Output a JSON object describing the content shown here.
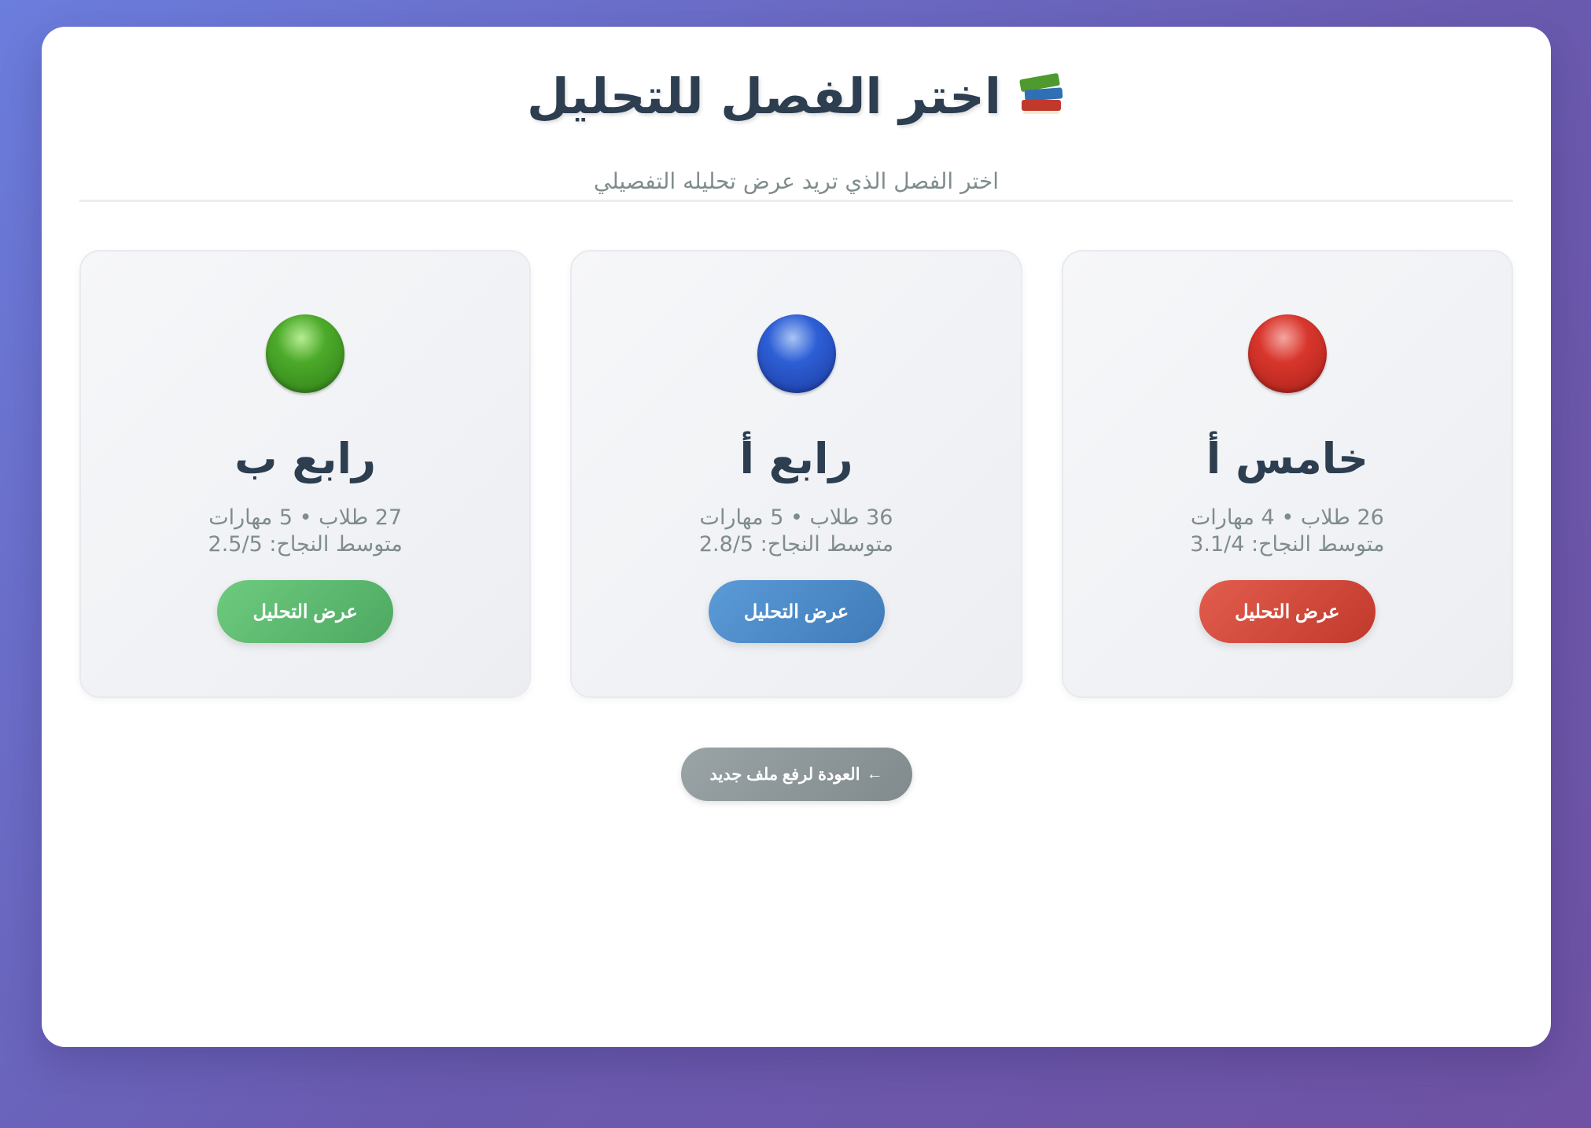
{
  "header": {
    "title": "اختر الفصل للتحليل",
    "title_icon": "books-icon",
    "subtitle": "اختر الفصل الذي تريد عرض تحليله التفصيلي"
  },
  "classes": [
    {
      "name": "خامس أ",
      "color_name": "red",
      "color": "#c0392b",
      "meta_line1": "26 طلاب • 4 مهارات",
      "meta_line2": "متوسط النجاح: 3.1/4",
      "button_label": "عرض التحليل"
    },
    {
      "name": "رابع أ",
      "color_name": "blue",
      "color": "#2e5fd6",
      "meta_line1": "36 طلاب • 5 مهارات",
      "meta_line2": "متوسط النجاح: 2.8/5",
      "button_label": "عرض التحليل"
    },
    {
      "name": "رابع ب",
      "color_name": "green",
      "color": "#4caa2a",
      "meta_line1": "27 طلاب • 5 مهارات",
      "meta_line2": "متوسط النجاح: 2.5/5",
      "button_label": "عرض التحليل"
    }
  ],
  "footer": {
    "back_label": "العودة لرفع ملف جديد",
    "back_arrow": "←"
  }
}
